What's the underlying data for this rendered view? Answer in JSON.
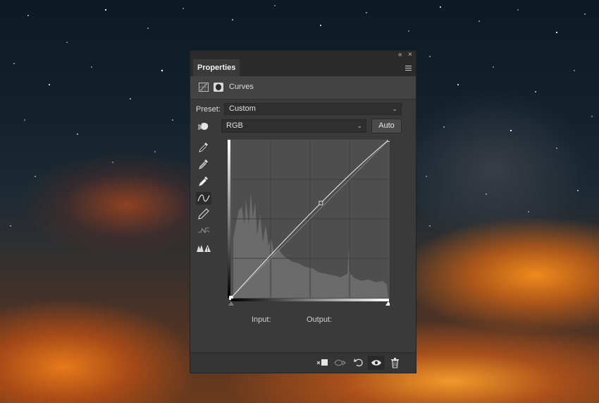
{
  "window": {
    "collapse_glyph": "«",
    "close_glyph": "×"
  },
  "panel": {
    "tab_label": "Properties",
    "menu_icon": "panel-menu-icon"
  },
  "header": {
    "title": "Curves",
    "icons": [
      "curves-adjustment-icon",
      "layer-mask-icon"
    ]
  },
  "preset": {
    "label": "Preset:",
    "value": "Custom"
  },
  "channel": {
    "value": "RGB",
    "auto_label": "Auto",
    "target_icon": "on-image-adjustment-icon"
  },
  "tools": [
    {
      "name": "black-point-eyedropper-icon"
    },
    {
      "name": "gray-point-eyedropper-icon"
    },
    {
      "name": "white-point-eyedropper-icon"
    },
    {
      "name": "edit-points-curve-icon",
      "active": true
    },
    {
      "name": "draw-pencil-icon"
    },
    {
      "name": "smooth-curve-icon"
    },
    {
      "name": "clipping-warning-icon"
    }
  ],
  "curve": {
    "points": [
      [
        0,
        0
      ],
      [
        145,
        153
      ],
      [
        255,
        255
      ]
    ],
    "input_label": "Input:",
    "output_label": "Output:"
  },
  "bottom_bar": [
    "clip-to-layer-icon",
    "view-previous-state-icon",
    "reset-adjustments-icon",
    "toggle-visibility-icon",
    "delete-adjustment-icon"
  ],
  "colors": {
    "panel_bg": "#3a3a3a",
    "graph_bg": "#4e4e4e",
    "histogram": "#6b6b6b"
  }
}
